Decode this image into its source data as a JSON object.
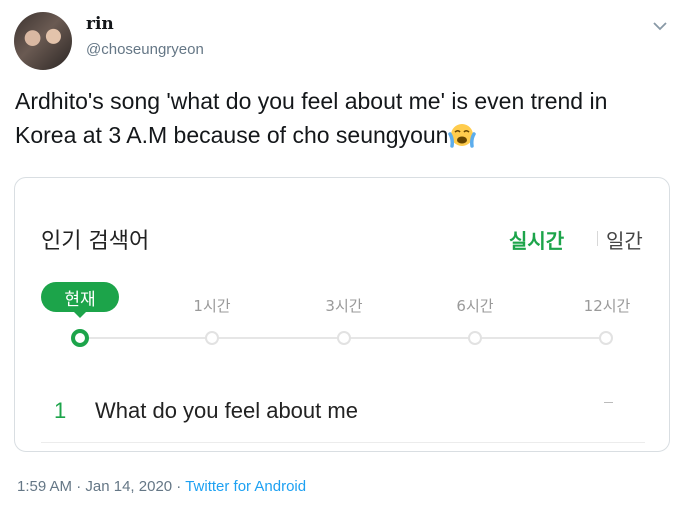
{
  "tweet": {
    "author": {
      "name": "rin",
      "handle": "@choseungryeon"
    },
    "text": "Ardhito's song 'what do you feel about me' is even trend in Korea at 3 A.M because of cho seungyoun",
    "emoji": "loudly-crying-face"
  },
  "card": {
    "title": "인기 검색어",
    "tabs": {
      "realtime": "실시간",
      "daily": "일간"
    },
    "now_label": "현재",
    "timeline": [
      "1시간",
      "3시간",
      "6시간",
      "12시간"
    ],
    "ranking": [
      {
        "rank": "1",
        "term": "What do you feel about me",
        "change": "–"
      }
    ],
    "accent": "#1ca44a"
  },
  "meta": {
    "time": "1:59 AM",
    "sep1": " · ",
    "date": "Jan 14, 2020",
    "sep2": " · ",
    "source": "Twitter for Android"
  }
}
